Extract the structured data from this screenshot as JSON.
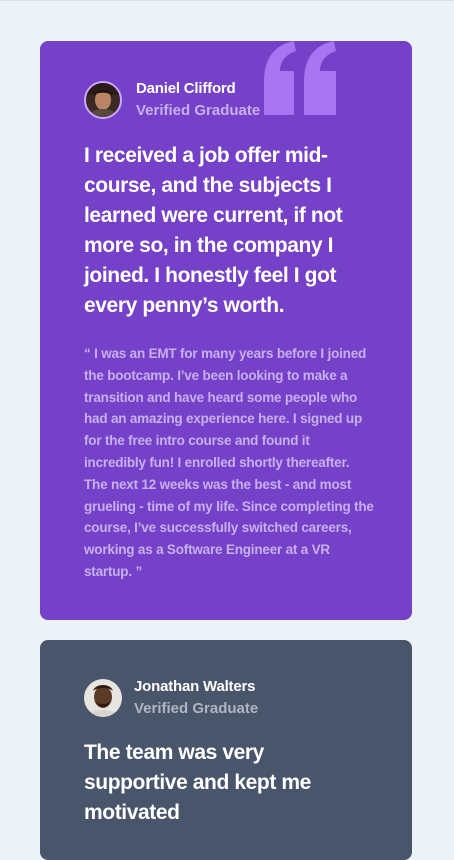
{
  "testimonials": [
    {
      "name": "Daniel Clifford",
      "role": "Verified Graduate",
      "headline": "I received a job offer mid-course, and the subjects I learned were current, if not more so, in the company I joined. I honestly feel I got every penny’s worth.",
      "quote": "“ I was an EMT for many years before I joined the bootcamp. I’ve been looking to make a transition and have heard some people who had an amazing experience here. I signed up for the free intro course and found it incredibly fun! I enrolled shortly thereafter. The next 12 weeks was the best - and most grueling - time of my life. Since completing the course, I’ve successfully switched careers, working as a Software Engineer at a VR startup. ”",
      "card_color": "#7541c8"
    },
    {
      "name": "Jonathan Walters",
      "role": "Verified Graduate",
      "headline": "The team was very supportive and kept me motivated",
      "card_color": "#48556a"
    }
  ],
  "icons": {
    "quote": "quotation-mark-icon",
    "avatar_1": "avatar-daniel",
    "avatar_2": "avatar-jonathan"
  },
  "colors": {
    "background": "#edf2f8",
    "purple": "#7541c8",
    "slate": "#48556a",
    "quote_mark": "#a775f1"
  }
}
